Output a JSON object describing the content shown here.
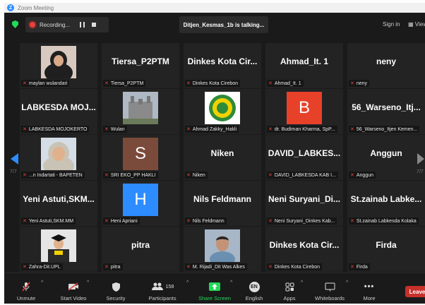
{
  "window": {
    "title": "Zoom Meeting"
  },
  "topbar": {
    "recording": "Recording...",
    "talking": "Ditjen_Kesmas_1b is talking...",
    "signin": "Sign in",
    "view": "View"
  },
  "tiles": [
    {
      "name": "",
      "label": "maylan wulandari",
      "kind": "photo",
      "photo": "woman-hijab"
    },
    {
      "name": "Tiersa_P2PTM",
      "label": "Tiersa_P2PTM"
    },
    {
      "name": "Dinkes Kota Cir...",
      "label": "Dinkes Kota Cirebon"
    },
    {
      "name": "Ahmad_It. 1",
      "label": "Ahmad_It. 1"
    },
    {
      "name": "neny",
      "label": "neny"
    },
    {
      "name": "LABKESDA MOJ...",
      "label": "LABKESDA MOJOKERTO"
    },
    {
      "name": "",
      "label": "Wulan",
      "kind": "photo",
      "photo": "building"
    },
    {
      "name": "",
      "label": "Ahmad Zakky_Hakli",
      "kind": "photo",
      "photo": "emblem"
    },
    {
      "name": "",
      "label": "dr. Budiman Kharma, SpP...",
      "kind": "letter",
      "letter": "B",
      "color": "#e8412a"
    },
    {
      "name": "56_Warseno_Itj...",
      "label": "56_Warseno_Itjen Kemen..."
    },
    {
      "name": "",
      "label": "...n Indartati - BAPETEN",
      "kind": "photo",
      "photo": "woman-hijab-2"
    },
    {
      "name": "",
      "label": "SRI EKO_PP HAKLI",
      "kind": "letter",
      "letter": "S",
      "color": "#7a4a3a"
    },
    {
      "name": "Niken",
      "label": "Niken"
    },
    {
      "name": "DAVID_LABKES...",
      "label": "DAVID_LABKESDA KAB I..."
    },
    {
      "name": "Anggun",
      "label": "Anggun"
    },
    {
      "name": "Yeni Astuti,SKM...",
      "label": "Yeni Astuti,SKM.MM"
    },
    {
      "name": "",
      "label": "Heni Apriani",
      "kind": "letter",
      "letter": "H",
      "color": "#2d8cff"
    },
    {
      "name": "Nils Feldmann",
      "label": "Nils Feldmann"
    },
    {
      "name": "Neni Suryani_Di...",
      "label": "Neni Suryani_Dinkes Kab..."
    },
    {
      "name": "St.zainab Labke...",
      "label": "St.zainab Labkesda Kolaka"
    },
    {
      "name": "",
      "label": "Zahra-Dit.UPL",
      "kind": "photo",
      "photo": "graduate"
    },
    {
      "name": "pitra",
      "label": "pitra"
    },
    {
      "name": "",
      "label": "M. Rijadi_Dit Was Alkes",
      "kind": "photo",
      "photo": "man"
    },
    {
      "name": "Dinkes Kota Cir...",
      "label": "Dinkes Kota Cirebon"
    },
    {
      "name": "Firda",
      "label": "Firda"
    }
  ],
  "pages": {
    "left": "7/7",
    "right": "7/7"
  },
  "toolbar": {
    "unmute": "Unmute",
    "video": "Start Video",
    "security": "Security",
    "participants": "Participants",
    "participants_count": "158",
    "share": "Share Screen",
    "language": "English",
    "language_code": "EN",
    "apps": "Apps",
    "whiteboards": "Whiteboards",
    "more": "More",
    "leave": "Leave"
  },
  "colors": {
    "share": "#23d959",
    "leave": "#c8302b",
    "accent": "#2d8cff"
  }
}
